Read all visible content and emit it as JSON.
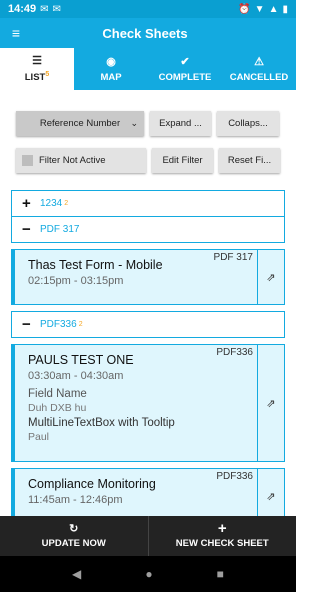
{
  "status": {
    "time": "14:49",
    "icons_left": [
      "✉",
      "✉"
    ],
    "icons_right": [
      "⏰",
      "▼",
      "▲",
      "▮"
    ]
  },
  "app": {
    "title": "Check Sheets",
    "menu_icon": "≡"
  },
  "tabs": [
    {
      "label": "LIST",
      "badge": "5",
      "icon": "☰",
      "active": true
    },
    {
      "label": "MAP",
      "icon": "◉"
    },
    {
      "label": "COMPLETE",
      "icon": "✔"
    },
    {
      "label": "CANCELLED",
      "icon": "⚠"
    }
  ],
  "filters": {
    "sort_select": "Reference Number",
    "expand": "Expand ...",
    "collapse": "Collaps...",
    "filter_status": "Filter Not Active",
    "edit_filter": "Edit Filter",
    "reset_filter": "Reset Fi..."
  },
  "groups": [
    {
      "sign": "+",
      "label": "1234",
      "badge": "2"
    },
    {
      "sign": "−",
      "label": "PDF 317"
    },
    {
      "sign": "−",
      "label": "PDF336",
      "badge": "2"
    }
  ],
  "cards": [
    {
      "ref": "PDF 317",
      "title": "Thas Test Form - Mobile",
      "time": "02:15pm - 03:15pm"
    },
    {
      "ref": "PDF336",
      "title": "PAULS TEST ONE",
      "time": "03:30am - 04:30am",
      "field1_label": "Field Name",
      "field1_value": "Duh DXB hu",
      "field2_label": "MultiLineTextBox with Tooltip",
      "field2_value": "Paul"
    },
    {
      "ref": "PDF336",
      "title": "Compliance Monitoring",
      "time": "11:45am - 12:46pm"
    }
  ],
  "share_icon": "⇗",
  "bottom": {
    "update": "UPDATE NOW",
    "update_icon": "↻",
    "new": "NEW CHECK SHEET",
    "new_icon": "+"
  },
  "nav": {
    "back": "◀",
    "home": "●",
    "recent": "■"
  }
}
